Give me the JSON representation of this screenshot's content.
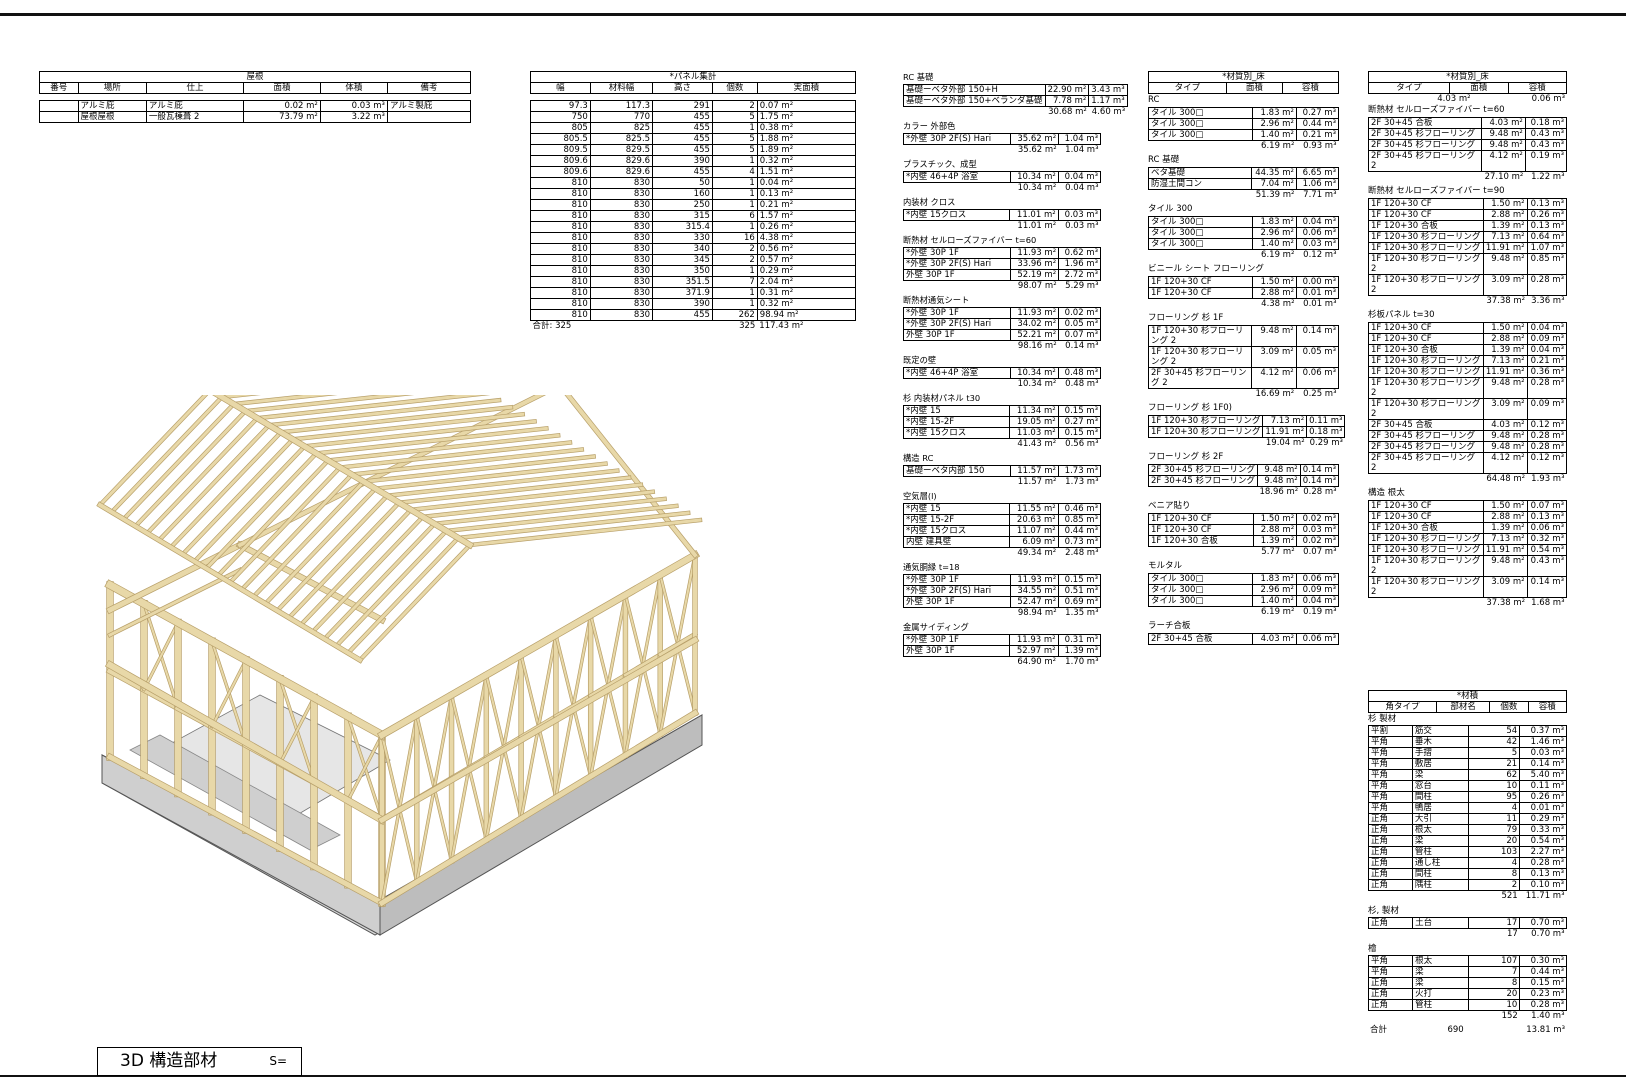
{
  "roof": {
    "title": "屋根",
    "headers": [
      "番号",
      "場所",
      "仕上",
      "面積",
      "体積",
      "備考"
    ],
    "rows": [
      [
        "",
        "アルミ庇",
        "アルミ庇",
        "0.02 m²",
        "0.03 m³",
        "アルミ製庇"
      ],
      [
        "",
        "屋根屋根",
        "一般瓦棟葺 2",
        "73.79 m²",
        "3.22 m³",
        ""
      ]
    ]
  },
  "panel": {
    "title": "*パネル集計",
    "headers": [
      "幅",
      "材料幅",
      "高さ",
      "個数",
      "実面積"
    ],
    "rows": [
      [
        "97.3",
        "117.3",
        "291",
        "2",
        "0.07 m²"
      ],
      [
        "750",
        "770",
        "455",
        "5",
        "1.75 m²"
      ],
      [
        "805",
        "825",
        "455",
        "1",
        "0.38 m²"
      ],
      [
        "805.5",
        "825.5",
        "455",
        "5",
        "1.88 m²"
      ],
      [
        "809.5",
        "829.5",
        "455",
        "5",
        "1.89 m²"
      ],
      [
        "809.6",
        "829.6",
        "390",
        "1",
        "0.32 m²"
      ],
      [
        "809.6",
        "829.6",
        "455",
        "4",
        "1.51 m²"
      ],
      [
        "810",
        "830",
        "50",
        "1",
        "0.04 m²"
      ],
      [
        "810",
        "830",
        "160",
        "1",
        "0.13 m²"
      ],
      [
        "810",
        "830",
        "250",
        "1",
        "0.21 m²"
      ],
      [
        "810",
        "830",
        "315",
        "6",
        "1.57 m²"
      ],
      [
        "810",
        "830",
        "315.4",
        "1",
        "0.26 m²"
      ],
      [
        "810",
        "830",
        "330",
        "16",
        "4.38 m²"
      ],
      [
        "810",
        "830",
        "340",
        "2",
        "0.56 m²"
      ],
      [
        "810",
        "830",
        "345",
        "2",
        "0.57 m²"
      ],
      [
        "810",
        "830",
        "350",
        "1",
        "0.29 m²"
      ],
      [
        "810",
        "830",
        "351.5",
        "7",
        "2.04 m²"
      ],
      [
        "810",
        "830",
        "371.9",
        "1",
        "0.31 m²"
      ],
      [
        "810",
        "830",
        "390",
        "1",
        "0.32 m²"
      ],
      [
        "810",
        "830",
        "455",
        "262",
        "98.94 m²"
      ]
    ],
    "total_label": "合計: 325",
    "total_count": "325",
    "total_area": "117.43 m²"
  },
  "materials_col1": [
    {
      "title": "RC 基礎",
      "rows": [
        [
          "基礎ーベタ外部 150+H",
          "22.90 m²",
          "3.43 m³"
        ],
        [
          "基礎ーベタ外部 150+ベランダ基礎",
          "7.78 m²",
          "1.17 m³"
        ]
      ],
      "subtotal": [
        "30.68 m²",
        "4.60 m³"
      ]
    },
    {
      "title": "カラー 外部色",
      "rows": [
        [
          "*外壁 30P 2F(S) Hari",
          "35.62 m²",
          "1.04 m³"
        ]
      ],
      "subtotal": [
        "35.62 m²",
        "1.04 m³"
      ]
    },
    {
      "title": "プラスチック、成型",
      "rows": [
        [
          "*内壁 46+4P 浴室",
          "10.34 m²",
          "0.04 m³"
        ]
      ],
      "subtotal": [
        "10.34 m²",
        "0.04 m³"
      ]
    },
    {
      "title": "内装材 クロス",
      "rows": [
        [
          "*内壁 15クロス",
          "11.01 m²",
          "0.03 m³"
        ]
      ],
      "subtotal": [
        "11.01 m²",
        "0.03 m³"
      ]
    },
    {
      "title": "断熱材 セルローズファイバー t=60",
      "rows": [
        [
          "*外壁 30P 1F",
          "11.93 m²",
          "0.62 m³"
        ],
        [
          "*外壁 30P 2F(S) Hari",
          "33.96 m²",
          "1.96 m³"
        ],
        [
          "外壁 30P 1F",
          "52.19 m²",
          "2.72 m³"
        ]
      ],
      "subtotal": [
        "98.07 m²",
        "5.29 m³"
      ]
    },
    {
      "title": "断熱材通気シート",
      "rows": [
        [
          "*外壁 30P 1F",
          "11.93 m²",
          "0.02 m³"
        ],
        [
          "*外壁 30P 2F(S) Hari",
          "34.02 m²",
          "0.05 m³"
        ],
        [
          "外壁 30P 1F",
          "52.21 m²",
          "0.07 m³"
        ]
      ],
      "subtotal": [
        "98.16 m²",
        "0.14 m³"
      ]
    },
    {
      "title": "既定の壁",
      "rows": [
        [
          "*内壁 46+4P 浴室",
          "10.34 m²",
          "0.48 m³"
        ]
      ],
      "subtotal": [
        "10.34 m²",
        "0.48 m³"
      ]
    },
    {
      "title": "杉 内装材パネル t30",
      "rows": [
        [
          "*内壁 15",
          "11.34 m²",
          "0.15 m³"
        ],
        [
          "*内壁 15-2F",
          "19.05 m²",
          "0.27 m³"
        ],
        [
          "*内壁 15クロス",
          "11.03 m²",
          "0.15 m³"
        ]
      ],
      "subtotal": [
        "41.43 m²",
        "0.56 m³"
      ]
    },
    {
      "title": "構造 RC",
      "rows": [
        [
          "基礎ーベタ内部 150",
          "11.57 m²",
          "1.73 m³"
        ]
      ],
      "subtotal": [
        "11.57 m²",
        "1.73 m³"
      ]
    },
    {
      "title": "空気層(l)",
      "rows": [
        [
          "*内壁 15",
          "11.55 m²",
          "0.46 m³"
        ],
        [
          "*内壁 15-2F",
          "20.63 m²",
          "0.85 m³"
        ],
        [
          "*内壁 15クロス",
          "11.07 m²",
          "0.44 m³"
        ],
        [
          "内壁 建具壁",
          "6.09 m²",
          "0.73 m³"
        ]
      ],
      "subtotal": [
        "49.34 m²",
        "2.48 m³"
      ]
    },
    {
      "title": "通気胴縁 t=18",
      "rows": [
        [
          "*外壁 30P 1F",
          "11.93 m²",
          "0.15 m³"
        ],
        [
          "*外壁 30P 2F(S) Hari",
          "34.55 m²",
          "0.51 m³"
        ],
        [
          "外壁 30P 1F",
          "52.47 m²",
          "0.69 m³"
        ]
      ],
      "subtotal": [
        "98.94 m²",
        "1.35 m³"
      ]
    },
    {
      "title": "金属サイディング",
      "rows": [
        [
          "*外壁 30P 1F",
          "11.93 m²",
          "0.31 m³"
        ],
        [
          "外壁 30P 1F",
          "52.97 m²",
          "1.39 m³"
        ]
      ],
      "subtotal": [
        "64.90 m²",
        "1.70 m³"
      ]
    }
  ],
  "floor_col2": {
    "title": "*材質別_床",
    "headers": [
      "タイプ",
      "面積",
      "容積"
    ],
    "groups": [
      {
        "title": "RC",
        "rows": [
          [
            "タイル 300□",
            "1.83 m²",
            "0.27 m³"
          ],
          [
            "タイル 300□",
            "2.96 m²",
            "0.44 m³"
          ],
          [
            "タイル 300□",
            "1.40 m²",
            "0.21 m³"
          ]
        ],
        "subtotal": [
          "6.19 m²",
          "0.93 m³"
        ]
      },
      {
        "title": "RC 基礎",
        "rows": [
          [
            "ベタ基礎",
            "44.35 m²",
            "6.65 m³"
          ],
          [
            "防湿土間コン",
            "7.04 m²",
            "1.06 m³"
          ]
        ],
        "subtotal": [
          "51.39 m²",
          "7.71 m³"
        ]
      },
      {
        "title": "タイル 300",
        "rows": [
          [
            "タイル 300□",
            "1.83 m²",
            "0.04 m³"
          ],
          [
            "タイル 300□",
            "2.96 m²",
            "0.06 m³"
          ],
          [
            "タイル 300□",
            "1.40 m²",
            "0.03 m³"
          ]
        ],
        "subtotal": [
          "6.19 m²",
          "0.12 m³"
        ]
      },
      {
        "title": "ビニール シート フローリング",
        "rows": [
          [
            "1F 120+30 CF",
            "1.50 m²",
            "0.00 m³"
          ],
          [
            "1F 120+30 CF",
            "2.88 m²",
            "0.01 m³"
          ]
        ],
        "subtotal": [
          "4.38 m²",
          "0.01 m³"
        ]
      },
      {
        "title": "フローリング 杉 1F",
        "rows": [
          [
            "1F 120+30 杉フローリング 2",
            "9.48 m²",
            "0.14 m³"
          ],
          [
            "1F 120+30 杉フローリング 2",
            "3.09 m²",
            "0.05 m³"
          ],
          [
            "2F 30+45 杉フローリング 2",
            "4.12 m²",
            "0.06 m³"
          ]
        ],
        "subtotal": [
          "16.69 m²",
          "0.25 m³"
        ]
      },
      {
        "title": "フローリング 杉 1F0)",
        "rows": [
          [
            "1F 120+30 杉フローリング",
            "7.13 m²",
            "0.11 m³"
          ],
          [
            "1F 120+30 杉フローリング",
            "11.91 m²",
            "0.18 m³"
          ]
        ],
        "subtotal": [
          "19.04 m²",
          "0.29 m³"
        ]
      },
      {
        "title": "フローリング 杉 2F",
        "rows": [
          [
            "2F 30+45 杉フローリング",
            "9.48 m²",
            "0.14 m³"
          ],
          [
            "2F 30+45 杉フローリング",
            "9.48 m²",
            "0.14 m³"
          ]
        ],
        "subtotal": [
          "18.96 m²",
          "0.28 m³"
        ]
      },
      {
        "title": "ベニア貼り",
        "rows": [
          [
            "1F 120+30 CF",
            "1.50 m²",
            "0.02 m³"
          ],
          [
            "1F 120+30 CF",
            "2.88 m²",
            "0.03 m³"
          ],
          [
            "1F 120+30 合板",
            "1.39 m²",
            "0.02 m³"
          ]
        ],
        "subtotal": [
          "5.77 m²",
          "0.07 m³"
        ]
      },
      {
        "title": "モルタル",
        "rows": [
          [
            "タイル 300□",
            "1.83 m²",
            "0.06 m³"
          ],
          [
            "タイル 300□",
            "2.96 m²",
            "0.09 m³"
          ],
          [
            "タイル 300□",
            "1.40 m²",
            "0.04 m³"
          ]
        ],
        "subtotal": [
          "6.19 m²",
          "0.19 m³"
        ]
      },
      {
        "title": "ラーチ合板",
        "rows": [
          [
            "2F 30+45 合板",
            "4.03 m²",
            "0.06 m³"
          ]
        ],
        "subtotal": null
      }
    ]
  },
  "floor_col3": {
    "title": "*材質別_床",
    "headers": [
      "タイプ",
      "面積",
      "容積"
    ],
    "top_subtotal": [
      "4.03 m²",
      "0.06 m³"
    ],
    "groups": [
      {
        "title": "断熱材 セルローズファイバー t=60",
        "rows": [
          [
            "2F 30+45 合板",
            "4.03 m²",
            "0.18 m³"
          ],
          [
            "2F 30+45 杉フローリング",
            "9.48 m²",
            "0.43 m³"
          ],
          [
            "2F 30+45 杉フローリング",
            "9.48 m²",
            "0.43 m³"
          ],
          [
            "2F 30+45 杉フローリング 2",
            "4.12 m²",
            "0.19 m³"
          ]
        ],
        "subtotal": [
          "27.10 m²",
          "1.22 m³"
        ]
      },
      {
        "title": "断熱材 セルローズファイバー t=90",
        "rows": [
          [
            "1F 120+30 CF",
            "1.50 m²",
            "0.13 m³"
          ],
          [
            "1F 120+30 CF",
            "2.88 m²",
            "0.26 m³"
          ],
          [
            "1F 120+30 合板",
            "1.39 m²",
            "0.13 m³"
          ],
          [
            "1F 120+30 杉フローリング",
            "7.13 m²",
            "0.64 m³"
          ],
          [
            "1F 120+30 杉フローリング",
            "11.91 m²",
            "1.07 m³"
          ],
          [
            "1F 120+30 杉フローリング 2",
            "9.48 m²",
            "0.85 m³"
          ],
          [
            "1F 120+30 杉フローリング 2",
            "3.09 m²",
            "0.28 m³"
          ]
        ],
        "subtotal": [
          "37.38 m²",
          "3.36 m³"
        ]
      },
      {
        "title": "杉板パネル t=30",
        "rows": [
          [
            "1F 120+30 CF",
            "1.50 m²",
            "0.04 m³"
          ],
          [
            "1F 120+30 CF",
            "2.88 m²",
            "0.09 m³"
          ],
          [
            "1F 120+30 合板",
            "1.39 m²",
            "0.04 m³"
          ],
          [
            "1F 120+30 杉フローリング",
            "7.13 m²",
            "0.21 m³"
          ],
          [
            "1F 120+30 杉フローリング",
            "11.91 m²",
            "0.36 m³"
          ],
          [
            "1F 120+30 杉フローリング 2",
            "9.48 m²",
            "0.28 m³"
          ],
          [
            "1F 120+30 杉フローリング 2",
            "3.09 m²",
            "0.09 m³"
          ],
          [
            "2F 30+45 合板",
            "4.03 m²",
            "0.12 m³"
          ],
          [
            "2F 30+45 杉フローリング",
            "9.48 m²",
            "0.28 m³"
          ],
          [
            "2F 30+45 杉フローリング",
            "9.48 m²",
            "0.28 m³"
          ],
          [
            "2F 30+45 杉フローリング 2",
            "4.12 m²",
            "0.12 m³"
          ]
        ],
        "subtotal": [
          "64.48 m²",
          "1.93 m³"
        ]
      },
      {
        "title": "構造 根太",
        "rows": [
          [
            "1F 120+30 CF",
            "1.50 m²",
            "0.07 m³"
          ],
          [
            "1F 120+30 CF",
            "2.88 m²",
            "0.13 m³"
          ],
          [
            "1F 120+30 合板",
            "1.39 m²",
            "0.06 m³"
          ],
          [
            "1F 120+30 杉フローリング",
            "7.13 m²",
            "0.32 m³"
          ],
          [
            "1F 120+30 杉フローリング",
            "11.91 m²",
            "0.54 m³"
          ],
          [
            "1F 120+30 杉フローリング 2",
            "9.48 m²",
            "0.43 m³"
          ],
          [
            "1F 120+30 杉フローリング 2",
            "3.09 m²",
            "0.14 m³"
          ]
        ],
        "subtotal": [
          "37.38 m²",
          "1.68 m³"
        ]
      }
    ]
  },
  "lumber": {
    "title": "*材積",
    "headers": [
      "角タイプ",
      "部材名",
      "個数",
      "容積"
    ],
    "groups": [
      {
        "title": "杉 製材",
        "rows": [
          [
            "平割",
            "筋交",
            "54",
            "0.37 m³"
          ],
          [
            "平角",
            "垂木",
            "42",
            "1.46 m³"
          ],
          [
            "平角",
            "手摺",
            "5",
            "0.03 m³"
          ],
          [
            "平角",
            "敷居",
            "21",
            "0.14 m³"
          ],
          [
            "平角",
            "梁",
            "62",
            "5.40 m³"
          ],
          [
            "平角",
            "窓台",
            "10",
            "0.11 m³"
          ],
          [
            "平角",
            "間柱",
            "95",
            "0.26 m³"
          ],
          [
            "平角",
            "鴨居",
            "4",
            "0.01 m³"
          ],
          [
            "正角",
            "大引",
            "11",
            "0.29 m³"
          ],
          [
            "正角",
            "根太",
            "79",
            "0.33 m³"
          ],
          [
            "正角",
            "梁",
            "20",
            "0.54 m³"
          ],
          [
            "正角",
            "管柱",
            "103",
            "2.27 m³"
          ],
          [
            "正角",
            "通し柱",
            "4",
            "0.28 m³"
          ],
          [
            "正角",
            "間柱",
            "8",
            "0.13 m³"
          ],
          [
            "正角",
            "隅柱",
            "2",
            "0.10 m³"
          ]
        ],
        "subtotal": [
          "521",
          "11.71 m³"
        ]
      },
      {
        "title": "杉, 製材",
        "rows": [
          [
            "正角",
            "土台",
            "17",
            "0.70 m³"
          ]
        ],
        "subtotal": [
          "17",
          "0.70 m³"
        ]
      },
      {
        "title": "檜",
        "rows": [
          [
            "平角",
            "根太",
            "107",
            "0.30 m³"
          ],
          [
            "平角",
            "梁",
            "7",
            "0.44 m³"
          ],
          [
            "正角",
            "梁",
            "8",
            "0.15 m³"
          ],
          [
            "正角",
            "火打",
            "20",
            "0.23 m³"
          ],
          [
            "正角",
            "管柱",
            "10",
            "0.28 m³"
          ]
        ],
        "subtotal": [
          "152",
          "1.40 m³"
        ]
      }
    ],
    "total_label": "合計",
    "total": [
      "690",
      "13.81 m³"
    ]
  },
  "title_block": {
    "title": "3D 構造部材",
    "scale": "S="
  },
  "colors": {
    "wood": "#e8d8a8",
    "wood_dark": "#b8a06a",
    "concrete": "#d8d8d8"
  }
}
